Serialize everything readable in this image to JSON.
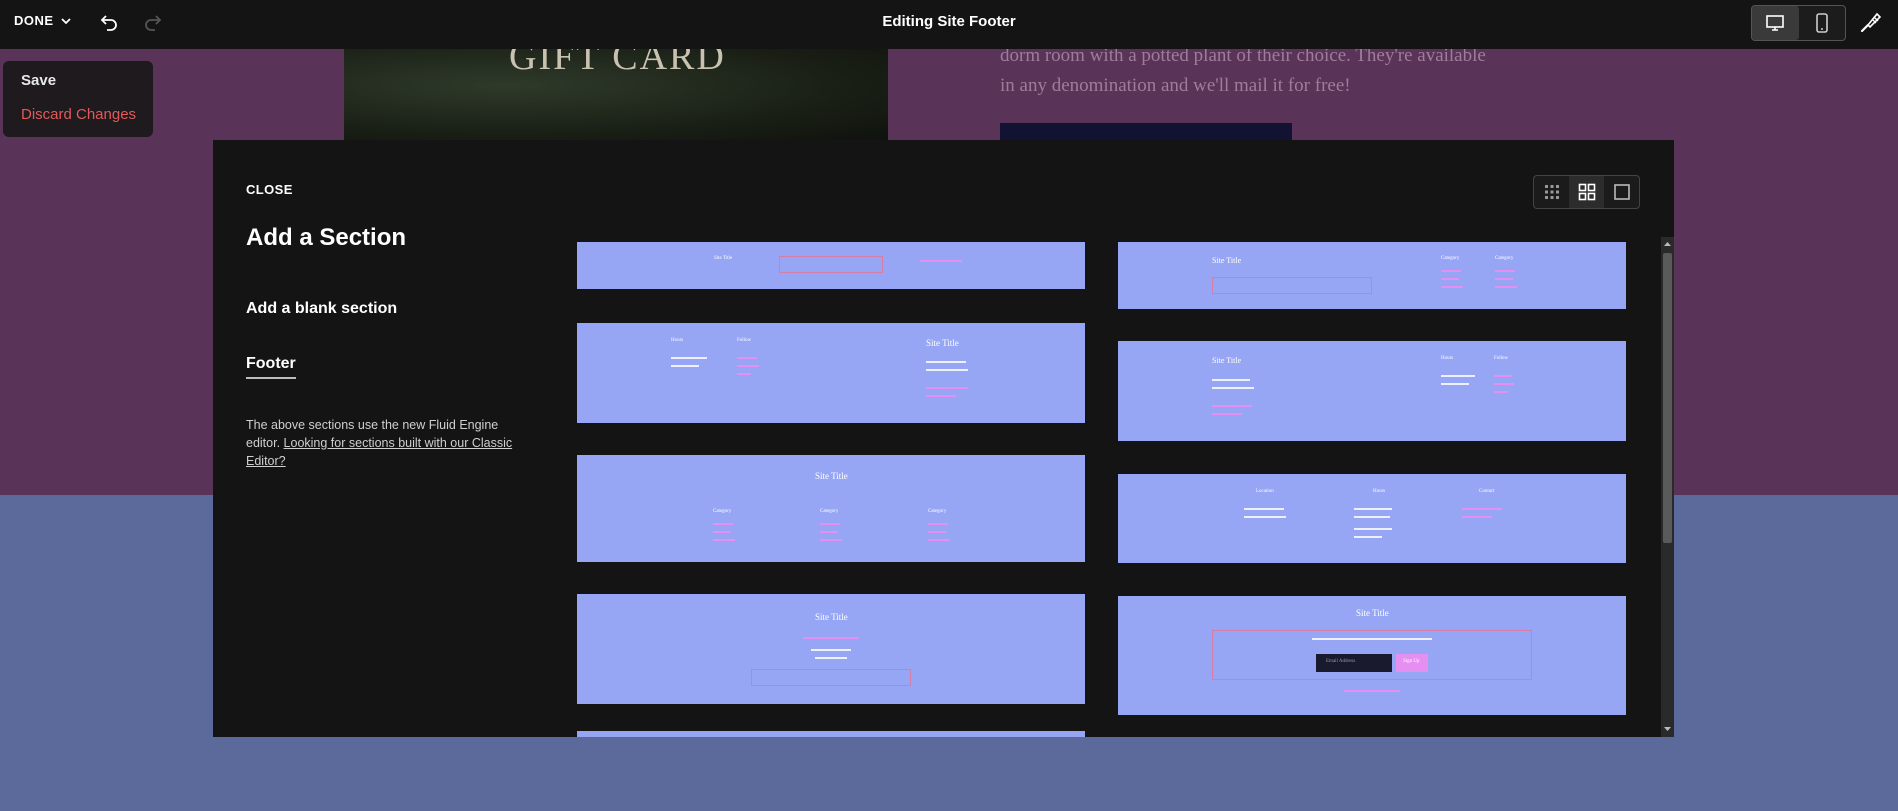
{
  "topbar": {
    "done_label": "DONE",
    "title": "Editing Site Footer"
  },
  "save_menu": {
    "save_label": "Save",
    "discard_label": "Discard Changes"
  },
  "background": {
    "image_text": "GIFT CARD",
    "text_line_1": "dorm room with a potted plant of their choice. They're available",
    "text_line_2": "in any denomination and we'll mail it for free!"
  },
  "modal": {
    "close_label": "CLOSE",
    "heading": "Add a Section",
    "blank_label": "Add a blank section",
    "category_label": "Footer",
    "note_text": "The above sections use the new Fluid Engine editor.",
    "note_link": "Looking for sections built with our Classic Editor?"
  },
  "thumbnails": {
    "site_title": "Site Title",
    "category": "Category",
    "hours": "Hours",
    "follow": "Follow",
    "location": "Location",
    "contact": "Contact",
    "email_placeholder": "Email Address",
    "sign_up": "Sign Up"
  },
  "colors": {
    "accent_pink": "#e58ff0",
    "thumb_bg": "#96a6f5",
    "danger": "#e05a5a"
  }
}
